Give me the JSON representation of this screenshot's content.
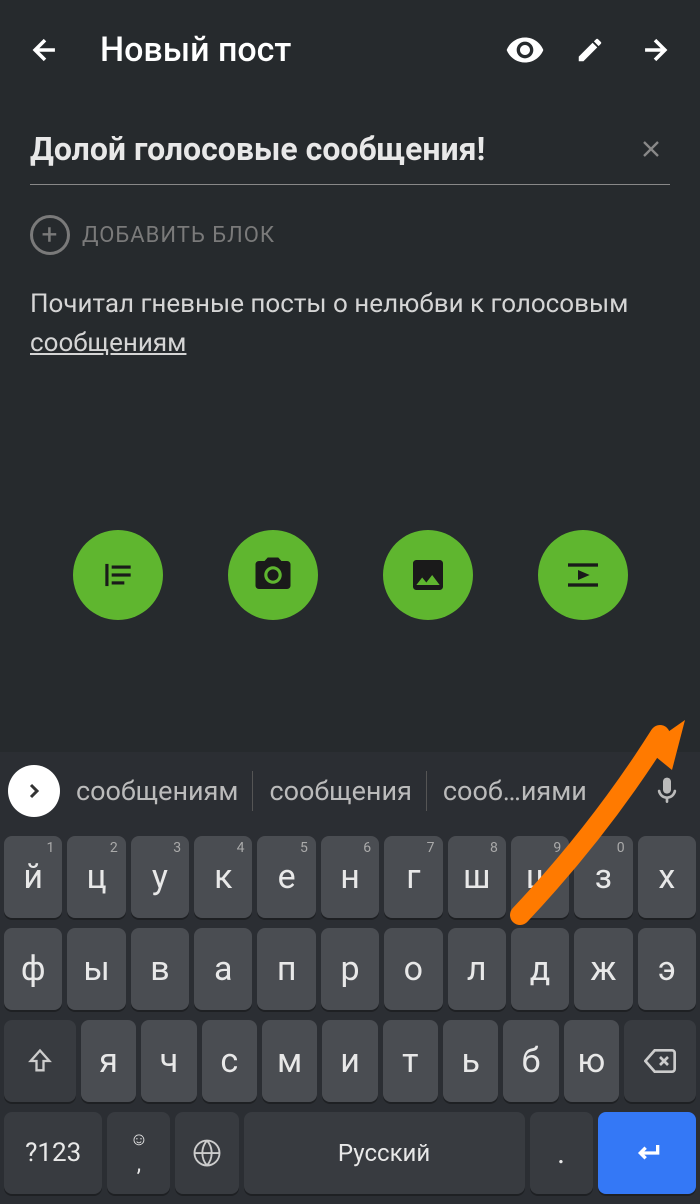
{
  "header": {
    "title": "Новый пост"
  },
  "post": {
    "title": "Долой голосовые сообщения!",
    "add_block_label": "ДОБАВИТЬ БЛОК",
    "body_text_prefix": "Почитал гневные посты о нелюбви к голосовым ",
    "body_text_underlined": "сообщениям"
  },
  "keyboard": {
    "suggestions": [
      "сообщениям",
      "сообщения",
      "сооб…иями"
    ],
    "row1": [
      {
        "k": "й",
        "s": "1"
      },
      {
        "k": "ц",
        "s": "2"
      },
      {
        "k": "у",
        "s": "3"
      },
      {
        "k": "к",
        "s": "4"
      },
      {
        "k": "е",
        "s": "5"
      },
      {
        "k": "н",
        "s": "6"
      },
      {
        "k": "г",
        "s": "7"
      },
      {
        "k": "ш",
        "s": "8"
      },
      {
        "k": "щ",
        "s": "9"
      },
      {
        "k": "з",
        "s": "0"
      },
      {
        "k": "х",
        "s": ""
      }
    ],
    "row2": [
      "ф",
      "ы",
      "в",
      "а",
      "п",
      "р",
      "о",
      "л",
      "д",
      "ж",
      "э"
    ],
    "row3": [
      "я",
      "ч",
      "с",
      "м",
      "и",
      "т",
      "ь",
      "б",
      "ю"
    ],
    "numkey": "?123",
    "comma": ",",
    "space_label": "Русский",
    "period": "."
  }
}
